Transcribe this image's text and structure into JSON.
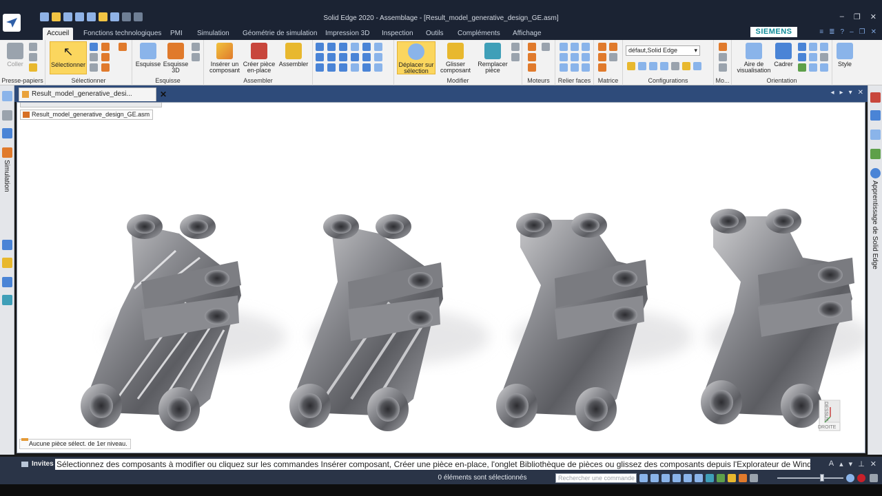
{
  "window": {
    "title": "Solid Edge 2020 - Assemblage - [Result_model_generative_design_GE.asm]"
  },
  "ribbon_tabs": [
    {
      "label": "Accueil",
      "active": true
    },
    {
      "label": "Fonctions technologiques"
    },
    {
      "label": "PMI"
    },
    {
      "label": "Simulation"
    },
    {
      "label": "Géométrie de simulation"
    },
    {
      "label": "Impression 3D"
    },
    {
      "label": "Inspection"
    },
    {
      "label": "Outils"
    },
    {
      "label": "Compléments"
    },
    {
      "label": "Affichage"
    }
  ],
  "brand": "SIEMENS",
  "ribbon": {
    "clipboard": {
      "paste_label": "Coller",
      "group": "Presse-papiers"
    },
    "select": {
      "button": "Sélectionner",
      "group": "Sélectionner"
    },
    "sketch": {
      "sketch": "Esquisse",
      "sketch3d_1": "Esquisse",
      "sketch3d_2": "3D",
      "group": "Esquisse"
    },
    "assemble": {
      "insert_1": "Insérer un",
      "insert_2": "composant",
      "create_1": "Créer pièce",
      "create_2": "en-place",
      "assemble": "Assembler",
      "group": "Assembler"
    },
    "modify": {
      "move_1": "Déplacer sur",
      "move_2": "sélection",
      "drag_1": "Glisser",
      "drag_2": "composant",
      "replace_1": "Remplacer",
      "replace_2": "pièce",
      "group": "Modifier"
    },
    "motors": {
      "group": "Moteurs"
    },
    "faces": {
      "group": "Relier faces"
    },
    "pattern": {
      "group": "Matrice"
    },
    "configurations": {
      "selected": "défaut,Solid Edge",
      "group": "Configurations"
    },
    "more": {
      "group": "Mo..."
    },
    "orientation": {
      "area_1": "Aire de",
      "area_2": "visualisation",
      "fit": "Cadrer",
      "group": "Orientation"
    },
    "style": {
      "label": "Style"
    }
  },
  "document": {
    "tab_label": "Result_model_generative_desi...",
    "tree_root": "Result_model_generative_design_GE.asm",
    "status_note": "Aucune pièce sélect. de 1er niveau.",
    "viewcube_top": "DESSUS",
    "viewcube_front": "DROITE"
  },
  "left_strip": {
    "label": "Simulation"
  },
  "right_strip": {
    "label": "Apprentissage de Solid Edge"
  },
  "prompt": {
    "title": "Invites",
    "text": "Sélectionnez des composants à modifier ou cliquez sur les commandes Insérer composant, Créer une pièce en-place, l'onglet Bibliothèque de pièces ou glissez des composants depuis l'Explorateur de Windows."
  },
  "status": {
    "selection_count": "0 éléments sont sélectionnés",
    "command_search_placeholder": "Rechercher une commande"
  },
  "colors": {
    "titlebar": "#1b2333",
    "ribbon": "#f2f2f2",
    "highlight": "#fbd65e",
    "siemens": "#0f8b98"
  }
}
